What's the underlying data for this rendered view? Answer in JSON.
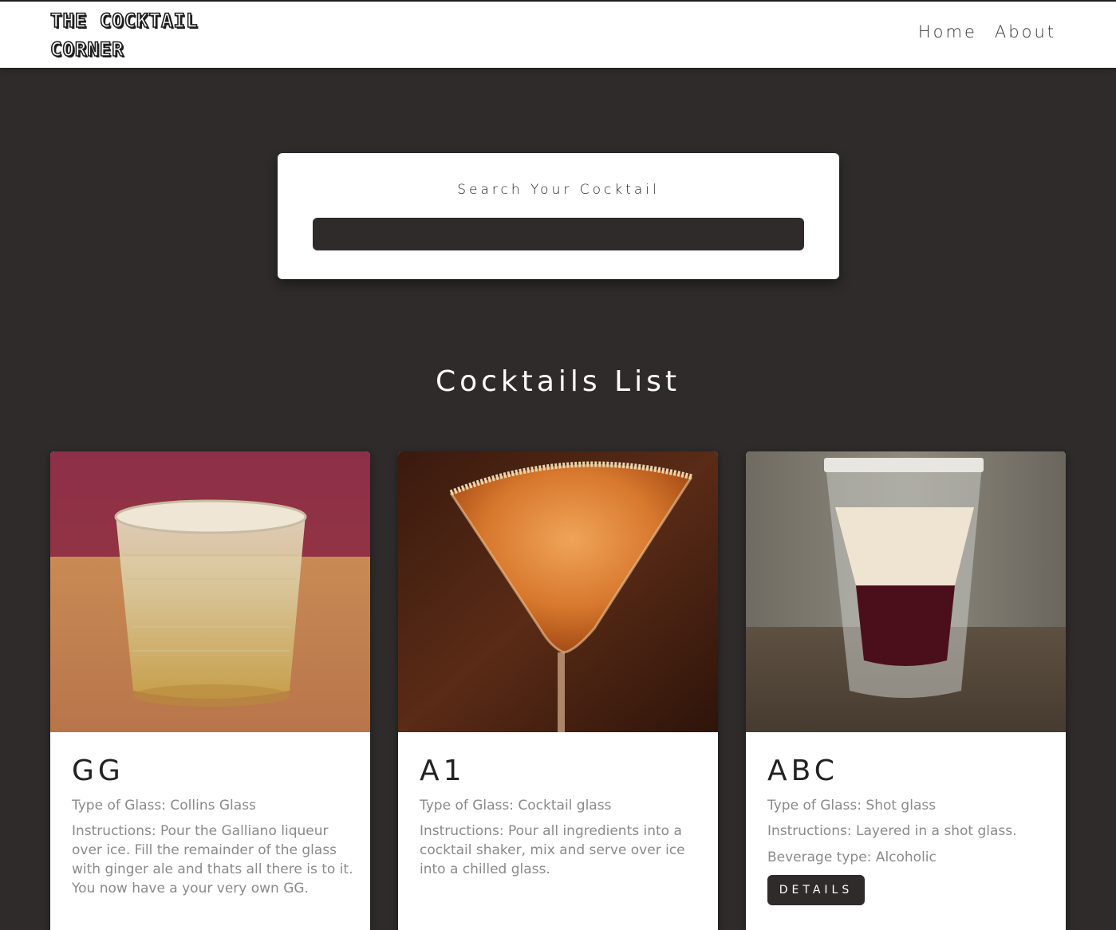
{
  "navbar": {
    "logo_text": "THE COCKTAIL CORNER",
    "links": [
      {
        "label": "Home"
      },
      {
        "label": "About"
      }
    ]
  },
  "search": {
    "label": "Search Your Cocktail",
    "value": ""
  },
  "list": {
    "title": "Cocktails List"
  },
  "cocktails": [
    {
      "name": "GG",
      "glass": "Type of Glass: Collins Glass",
      "instructions": "Instructions: Pour the Galliano liqueur over ice. Fill the remainder of the glass with ginger ale and thats all there is to it. You now have a your very own GG."
    },
    {
      "name": "A1",
      "glass": "Type of Glass: Cocktail glass",
      "instructions": "Instructions: Pour all ingredients into a cocktail shaker, mix and serve over ice into a chilled glass."
    },
    {
      "name": "ABC",
      "glass": "Type of Glass: Shot glass",
      "instructions": "Instructions: Layered in a shot glass.",
      "beverage": "Beverage type: Alcoholic",
      "details_label": "Details"
    }
  ],
  "colors": {
    "background": "#2f2b2b",
    "card": "#ffffff",
    "text_muted": "#8a8a8a"
  }
}
